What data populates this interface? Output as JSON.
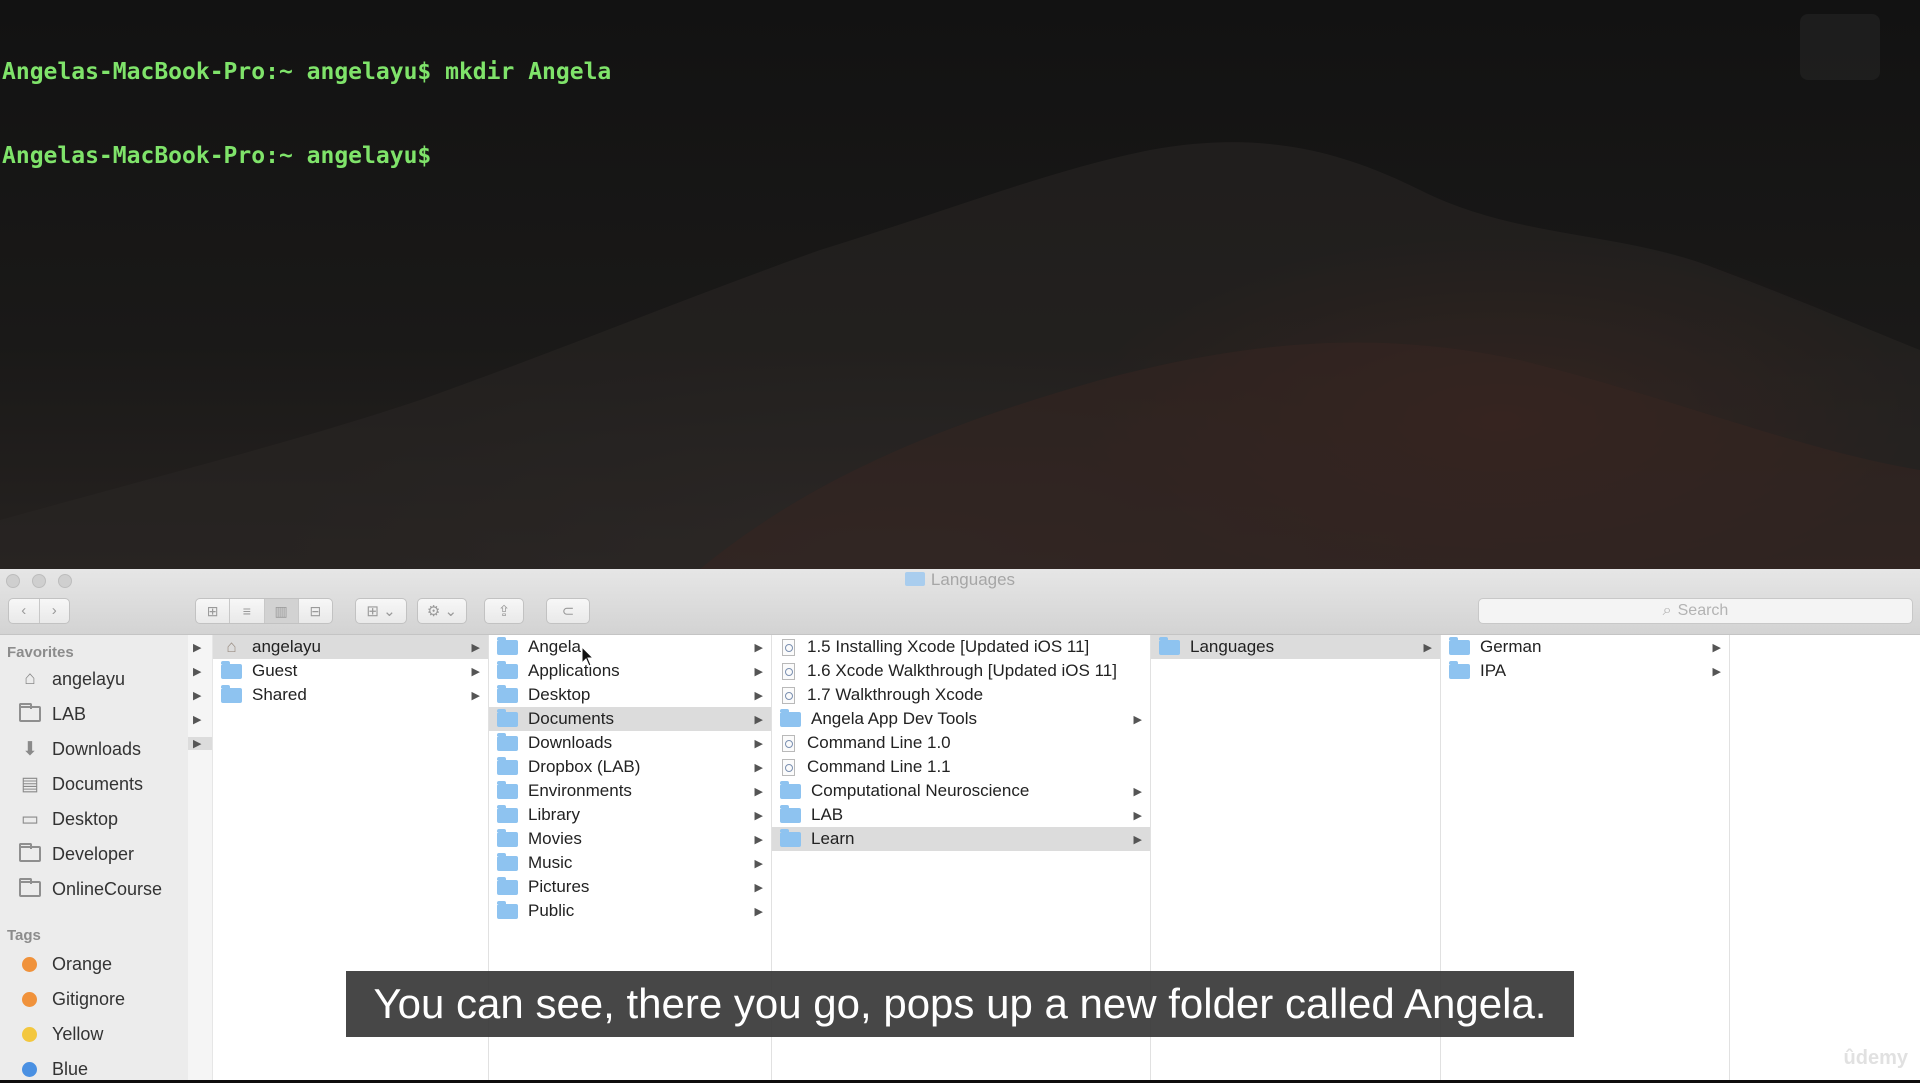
{
  "terminal": {
    "lines": [
      "Angelas-MacBook-Pro:~ angelayu$ mkdir Angela",
      "Angelas-MacBook-Pro:~ angelayu$"
    ]
  },
  "finder": {
    "window_title": "Languages",
    "search_placeholder": "Search",
    "toolbar": {
      "back": "‹",
      "forward": "›",
      "views": [
        "⊞",
        "≡",
        "▥",
        "⊟"
      ],
      "group": "⊞ ⌄",
      "action": "⚙ ⌄",
      "share": "⇪",
      "tag": "⊂"
    },
    "sidebar": {
      "favorites_header": "Favorites",
      "favorites": [
        {
          "label": "angelayu",
          "icon": "home-icon"
        },
        {
          "label": "LAB",
          "icon": "folder-icon"
        },
        {
          "label": "Downloads",
          "icon": "download-icon"
        },
        {
          "label": "Documents",
          "icon": "documents-icon"
        },
        {
          "label": "Desktop",
          "icon": "desktop-icon"
        },
        {
          "label": "Developer",
          "icon": "folder-icon"
        },
        {
          "label": "OnlineCourse",
          "icon": "folder-icon"
        }
      ],
      "tags_header": "Tags",
      "tags": [
        {
          "label": "Orange",
          "color": "#f0923b"
        },
        {
          "label": "Gitignore",
          "color": "#f0923b"
        },
        {
          "label": "Yellow",
          "color": "#f3c73e"
        },
        {
          "label": "Blue",
          "color": "#4a90e2"
        }
      ]
    },
    "columns": [
      {
        "items": [
          {
            "label": "angelayu",
            "icon": "home",
            "arrow": true,
            "selected": true
          },
          {
            "label": "Guest",
            "icon": "folder",
            "arrow": true
          },
          {
            "label": "Shared",
            "icon": "folder",
            "arrow": true
          }
        ]
      },
      {
        "items": [
          {
            "label": "Angela",
            "icon": "folder",
            "arrow": true
          },
          {
            "label": "Applications",
            "icon": "folder",
            "arrow": true
          },
          {
            "label": "Desktop",
            "icon": "folder",
            "arrow": true
          },
          {
            "label": "Documents",
            "icon": "folder",
            "arrow": true,
            "selected": true
          },
          {
            "label": "Downloads",
            "icon": "folder",
            "arrow": true
          },
          {
            "label": "Dropbox (LAB)",
            "icon": "folder",
            "arrow": true
          },
          {
            "label": "Environments",
            "icon": "folder",
            "arrow": true
          },
          {
            "label": "Library",
            "icon": "folder",
            "arrow": true
          },
          {
            "label": "Movies",
            "icon": "folder",
            "arrow": true
          },
          {
            "label": "Music",
            "icon": "folder",
            "arrow": true
          },
          {
            "label": "Pictures",
            "icon": "folder",
            "arrow": true
          },
          {
            "label": "Public",
            "icon": "folder",
            "arrow": true
          }
        ]
      },
      {
        "items": [
          {
            "label": "1.5 Installing Xcode [Updated iOS 11]",
            "icon": "doc",
            "arrow": false
          },
          {
            "label": "1.6 Xcode Walkthrough [Updated iOS 11]",
            "icon": "doc",
            "arrow": false
          },
          {
            "label": "1.7 Walkthrough Xcode",
            "icon": "doc",
            "arrow": false
          },
          {
            "label": "Angela App Dev Tools",
            "icon": "folder",
            "arrow": true
          },
          {
            "label": "Command Line 1.0",
            "icon": "doc",
            "arrow": false
          },
          {
            "label": "Command Line 1.1",
            "icon": "doc",
            "arrow": false
          },
          {
            "label": "Computational Neuroscience",
            "icon": "folder",
            "arrow": true
          },
          {
            "label": "LAB",
            "icon": "folder",
            "arrow": true
          },
          {
            "label": "Learn",
            "icon": "folder",
            "arrow": true,
            "selected": true
          }
        ]
      },
      {
        "items": [
          {
            "label": "Languages",
            "icon": "folder",
            "arrow": true,
            "selected": true
          }
        ]
      },
      {
        "items": [
          {
            "label": "German",
            "icon": "folder",
            "arrow": true
          },
          {
            "label": "IPA",
            "icon": "folder",
            "arrow": true
          }
        ]
      }
    ]
  },
  "caption": "You can see, there you go, pops up a new folder called Angela.",
  "watermark": "ûdemy"
}
